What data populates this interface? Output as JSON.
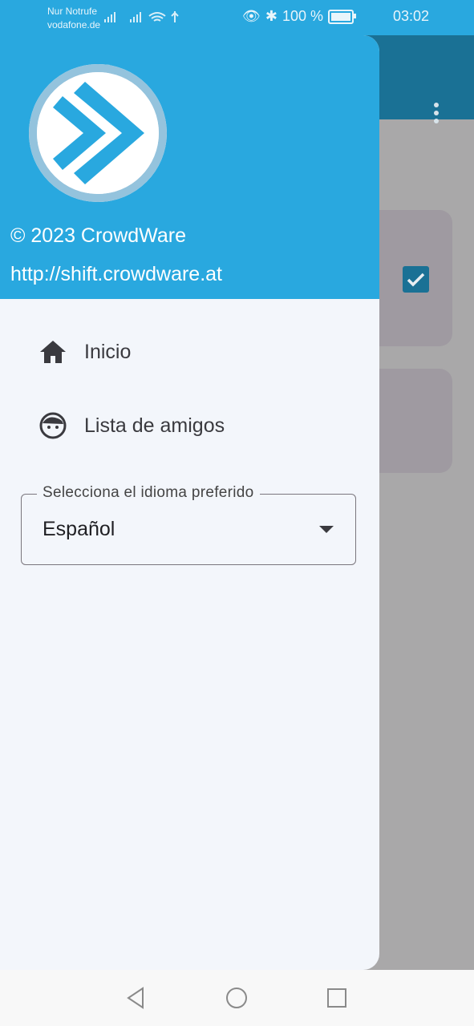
{
  "status": {
    "carrier_line1": "Nur Notrufe",
    "carrier_line2": "vodafone.de",
    "battery": "100 %",
    "time": "03:02"
  },
  "drawer": {
    "copyright": "© 2023 CrowdWare",
    "url": "http://shift.crowdware.at",
    "items": [
      {
        "label": "Inicio",
        "icon": "home-icon"
      },
      {
        "label": "Lista de amigos",
        "icon": "face-icon"
      }
    ],
    "language": {
      "legend": "Selecciona el idioma preferido",
      "value": "Español"
    }
  },
  "colors": {
    "primary": "#29a8df",
    "app_bar_dimmed": "#1a7195",
    "drawer_bg": "#f3f6fb"
  }
}
